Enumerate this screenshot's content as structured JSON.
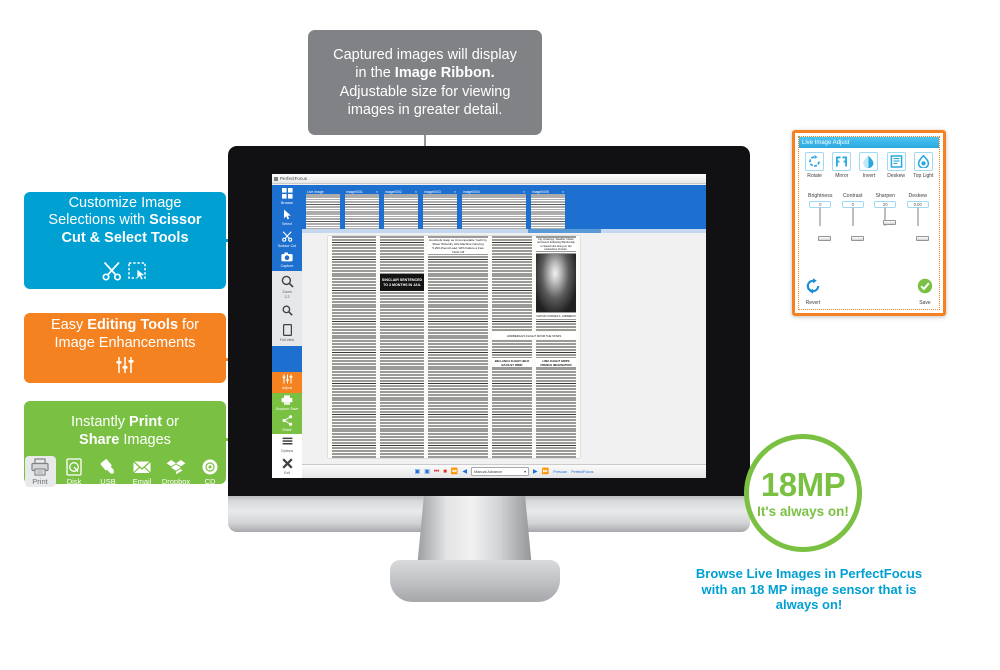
{
  "callouts": {
    "top": {
      "line1": "Captured images will display",
      "line2_pre": "in the ",
      "line2_bold": "Image Ribbon.",
      "line3": "Adjustable size for viewing",
      "line4": "images in greater detail.",
      "color": "#808285"
    },
    "blue": {
      "line1": "Customize Image",
      "line2_pre": "Selections with ",
      "line2_bold": "Scissor",
      "line3_bold": "Cut & Select Tools",
      "color": "#00a0d2",
      "icons": [
        "scissors-icon",
        "select-marquee-icon"
      ]
    },
    "orange": {
      "line1_pre": "Easy ",
      "line1_bold": "Editing Tools",
      "line1_post": " for",
      "line2": "Image Enhancements",
      "color": "#f58220",
      "icons": [
        "sliders-icon"
      ]
    },
    "green": {
      "line1_pre": "Instantly ",
      "line1_bold": "Print",
      "line1_post": " or",
      "line2_bold": "Share",
      "line2_post": " Images",
      "color": "#7ac143",
      "items": [
        {
          "label": "Print",
          "icon": "printer-icon",
          "selected": true
        },
        {
          "label": "Disk",
          "icon": "disk-icon",
          "selected": false
        },
        {
          "label": "USB",
          "icon": "usb-icon",
          "selected": false
        },
        {
          "label": "Email",
          "icon": "email-icon",
          "selected": false
        },
        {
          "label": "Dropbox",
          "icon": "dropbox-icon",
          "selected": false
        },
        {
          "label": "CD",
          "icon": "cd-icon",
          "selected": false
        }
      ]
    }
  },
  "app": {
    "title": "PerfectFocus",
    "sidebar": [
      {
        "label": "Browse",
        "icon": "browse-grid-icon",
        "theme": "blue"
      },
      {
        "label": "Select",
        "icon": "select-arrow-icon",
        "theme": "blue"
      },
      {
        "label": "Scissor Cut",
        "icon": "scissors-icon",
        "theme": "blue"
      },
      {
        "label": "Capture",
        "icon": "camera-icon",
        "theme": "blue"
      },
      {
        "label": "Zoom",
        "value": "2.2",
        "icon": "zoom-in-icon",
        "theme": "lightgray"
      },
      {
        "label": "",
        "icon": "zoom-out-icon",
        "theme": "lightgray"
      },
      {
        "label": "Full view",
        "icon": "full-view-icon",
        "theme": "lightgray"
      },
      {
        "label": "Adjust",
        "icon": "adjust-icon",
        "theme": "orange"
      },
      {
        "label": "Dropbox Save",
        "icon": "printer-icon",
        "theme": "green"
      },
      {
        "label": "Share",
        "icon": "share-icon",
        "theme": "green"
      },
      {
        "label": "Options",
        "icon": "options-icon",
        "theme": "white"
      },
      {
        "label": "Exit",
        "icon": "exit-x-icon",
        "theme": "white"
      }
    ],
    "ribbon": [
      {
        "label": "Live Image",
        "wide": false
      },
      {
        "label": "image0001",
        "wide": false
      },
      {
        "label": "image0002",
        "wide": false
      },
      {
        "label": "image0003",
        "wide": false
      },
      {
        "label": "image0004",
        "wide": true
      },
      {
        "label": "image0005",
        "wide": false
      }
    ],
    "page_headlines": [
      "SINCLAIR SENTENCED TO 3 MONTHS IN JAIL",
      "Hundreds Gasp as Uncomparable Youth by Sheer Wizardry Lifts Machine Carrying 5,200-Pound Load, With Failure a Few Yards Off",
      "BELLANCA FLIGHT HELD BACK BY WIND",
      "LIMA FLIGHT GRIPS FRENCH IMAGINATION",
      "Fig. Drawings, Weather Charts and Gents Following Winds Help to Speed Him Along on His Hazardous Venture.",
      "CAPTAIN CHARLES A. LINDBERGH",
      "LINDBERGH'S FLIGHT FROM THE STARS"
    ],
    "statusbar": {
      "mode": "Manual Advance",
      "left_label": "Prescan",
      "right_label": "PerfectFocus"
    }
  },
  "live_adjust": {
    "title": "Live Image Adjust",
    "tools": [
      {
        "label": "Rotate",
        "icon": "rotate-icon"
      },
      {
        "label": "Mirror",
        "icon": "mirror-icon"
      },
      {
        "label": "Invert",
        "icon": "invert-icon"
      },
      {
        "label": "Deskew",
        "icon": "deskew-icon"
      },
      {
        "label": "Top Light",
        "icon": "top-light-icon"
      }
    ],
    "sliders": [
      {
        "label": "Brightness",
        "value": "0",
        "pos": 50
      },
      {
        "label": "Contrast",
        "value": "0",
        "pos": 50
      },
      {
        "label": "Sharpen",
        "value": "20",
        "pos": 78
      },
      {
        "label": "Deskew",
        "value": "0.00",
        "pos": 50
      }
    ],
    "revert": {
      "label": "Revert",
      "icon": "revert-refresh-icon"
    },
    "save": {
      "label": "Save",
      "icon": "save-check-icon"
    }
  },
  "badge": {
    "headline": "18MP",
    "subline": "It's always on!",
    "color": "#7ac143"
  },
  "caption": {
    "line1": "Browse Live Images in PerfectFocus",
    "line2": "with an 18 MP image sensor that is",
    "line3": "always on!",
    "color": "#00a0d2"
  }
}
